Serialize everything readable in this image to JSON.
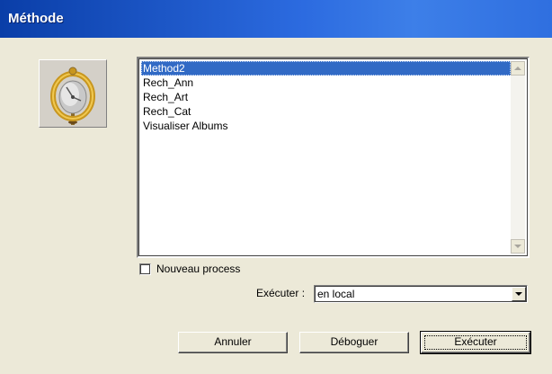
{
  "window": {
    "title": "Méthode"
  },
  "method_list": {
    "items": [
      "Method2",
      "Rech_Ann",
      "Rech_Art",
      "Rech_Cat",
      "Visualiser Albums"
    ],
    "selected": "Method2"
  },
  "options": {
    "new_process_label": "Nouveau process",
    "new_process_checked": false
  },
  "execute": {
    "label": "Exécuter :",
    "value": "en local"
  },
  "buttons": {
    "cancel": "Annuler",
    "debug": "Déboguer",
    "execute": "Exécuter"
  },
  "icons": {
    "method": "compass-clock-icon"
  }
}
